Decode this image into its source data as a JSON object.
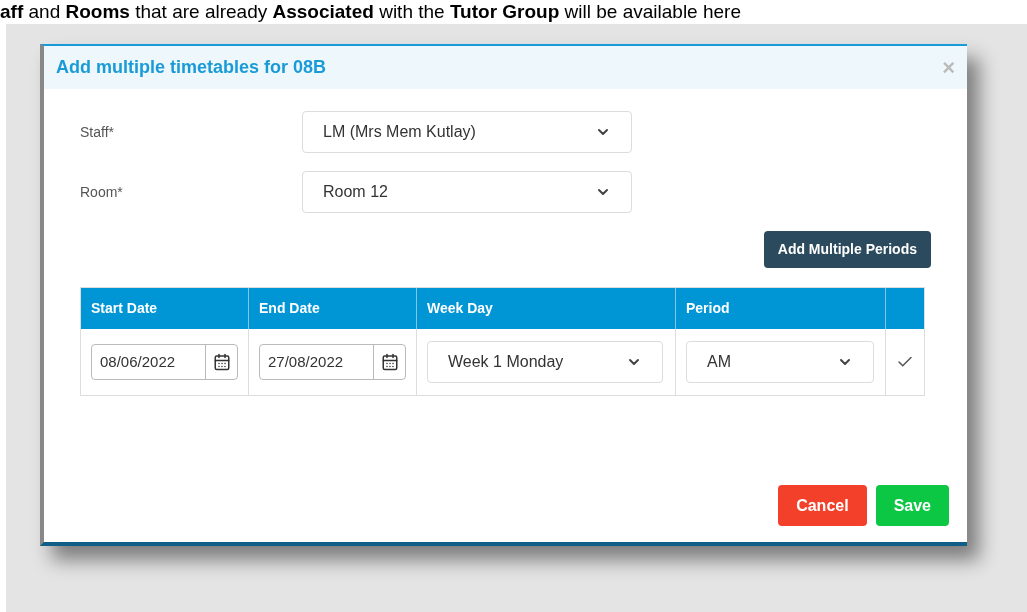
{
  "document_text": "**aff** and **Rooms** that are already **Associated** with the **Tutor Group** will be available here",
  "dialog": {
    "title": "Add multiple timetables for 08B",
    "close": "×",
    "fields": [
      {
        "label": "Staff*",
        "value": "LM (Mrs Mem Kutlay)"
      },
      {
        "label": "Room*",
        "value": "Room 12"
      }
    ],
    "add_button": "Add Multiple Periods",
    "table": {
      "columns": [
        "Start Date",
        "End Date",
        "Week Day",
        "Period"
      ],
      "rows": [
        {
          "start_date": "08/06/2022",
          "end_date": "27/08/2022",
          "week_day": "Week 1 Monday",
          "period": "AM"
        }
      ]
    },
    "buttons": [
      {
        "label": "Cancel",
        "kind": "cancel"
      },
      {
        "label": "Save",
        "kind": "save"
      }
    ]
  }
}
